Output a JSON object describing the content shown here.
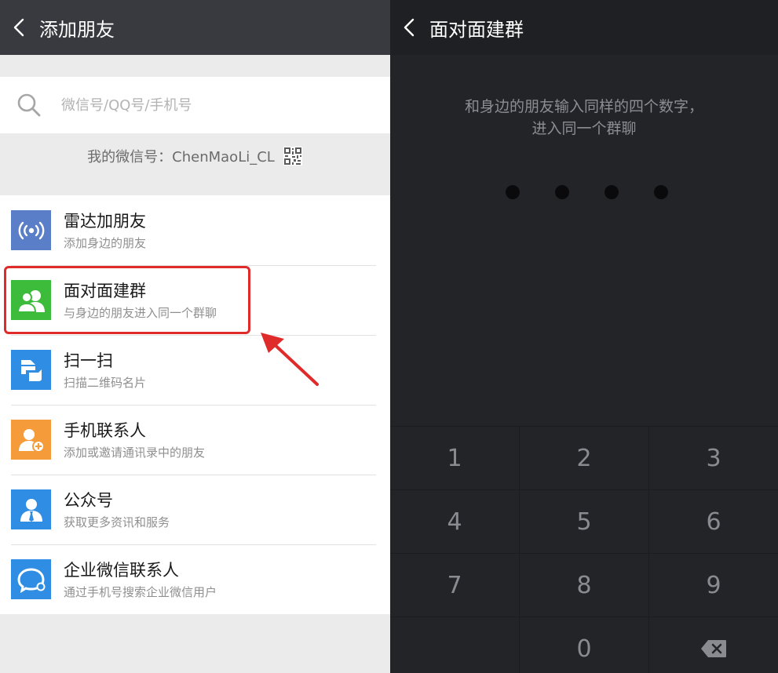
{
  "left": {
    "title": "添加朋友",
    "search": {
      "placeholder": "微信号/QQ号/手机号",
      "value": ""
    },
    "my_id_label": "我的微信号：ChenMaoLi_CL",
    "items": [
      {
        "title": "雷达加朋友",
        "sub": "添加身边的朋友",
        "icon": "radar-icon",
        "color": "#5b7ec9"
      },
      {
        "title": "面对面建群",
        "sub": "与身边的朋友进入同一个群聊",
        "icon": "face-to-face-group-icon",
        "color": "#3dbb3a"
      },
      {
        "title": "扫一扫",
        "sub": "扫描二维码名片",
        "icon": "scan-icon",
        "color": "#2f8de3"
      },
      {
        "title": "手机联系人",
        "sub": "添加或邀请通讯录中的朋友",
        "icon": "phone-contacts-icon",
        "color": "#f59b3a"
      },
      {
        "title": "公众号",
        "sub": "获取更多资讯和服务",
        "icon": "official-account-icon",
        "color": "#2f8de3"
      },
      {
        "title": "企业微信联系人",
        "sub": "通过手机号搜索企业微信用户",
        "icon": "wecom-icon",
        "color": "#2f8de3"
      }
    ],
    "highlight_color": "#e02b2b"
  },
  "right": {
    "title": "面对面建群",
    "instruction_line1": "和身边的朋友输入同样的四个数字，",
    "instruction_line2": "进入同一个群聊",
    "code_length": 4,
    "keypad": [
      [
        "1",
        "2",
        "3"
      ],
      [
        "4",
        "5",
        "6"
      ],
      [
        "7",
        "8",
        "9"
      ],
      [
        "",
        "0",
        "backspace-icon"
      ]
    ]
  }
}
